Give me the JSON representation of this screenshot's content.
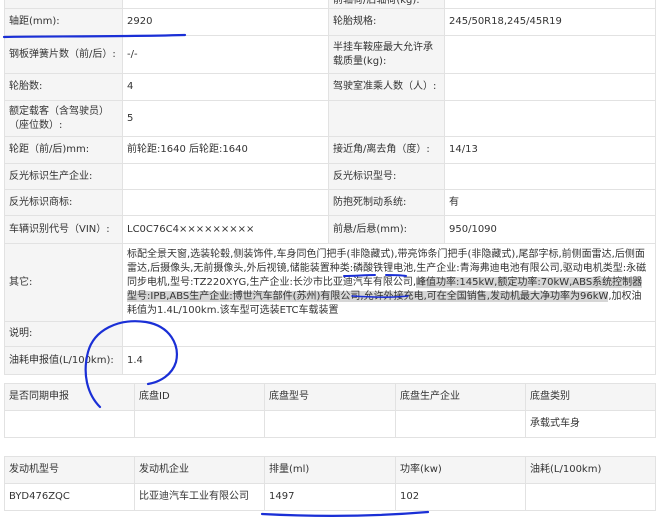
{
  "spec_rows": [
    {
      "l1": "",
      "v1": "",
      "l2": "前轴荷/后轴荷(kg):",
      "v2": ""
    },
    {
      "l1": "轴距(mm):",
      "v1": "2920",
      "l2": "轮胎规格:",
      "v2": "245/50R18,245/45R19"
    },
    {
      "l1": "钢板弹簧片数（前/后）:",
      "v1": "-/-",
      "l2": "半挂车鞍座最大允许承载质量(kg):",
      "v2": ""
    },
    {
      "l1": "轮胎数:",
      "v1": "4",
      "l2": "驾驶室准乘人数（人）:",
      "v2": ""
    },
    {
      "l1": "额定载客（含驾驶员）（座位数）:",
      "v1": "5",
      "l2": "",
      "v2": ""
    },
    {
      "l1": "轮距（前/后)mm:",
      "v1": "前轮距:1640 后轮距:1640",
      "l2": "接近角/离去角（度）:",
      "v2": "14/13"
    },
    {
      "l1": "反光标识生产企业:",
      "v1": "",
      "l2": "反光标识型号:",
      "v2": ""
    },
    {
      "l1": "反光标识商标:",
      "v1": "",
      "l2": "防抱死制动系统:",
      "v2": "有"
    },
    {
      "l1": "车辆识别代号（VIN）:",
      "v1": "LC0C76C4×××××××××",
      "l2": "前悬/后悬(mm):",
      "v2": "950/1090"
    }
  ],
  "other": {
    "label": "其它:",
    "text_a": "标配全景天窗,选装轮毂,侧装饰件,车身同色门把手(非隐藏式),带亮饰条门把手(非隐藏式),尾部字标,前侧面雷达,后侧面雷达,后摄像头,无前摄像头,外后视镜,储能装置种类:磷酸铁锂电池,生产企业:青海弗迪电池有限公司,驱动电机类型:永磁同步电机,型号:TZ220XYG,生产企业:长沙市比亚迪汽车有限公司,",
    "text_hl": "峰值功率:145kW,额定功率:70kW,ABS系统控制器型号:IPB,ABS生产企业:博世汽车部件(苏州)有限公司,允许外接充电,可在全国销售,发动机最大净功率为96kW",
    "text_b": ",加权油耗值为1.4L/100km.该车型可选装ETC车载装置"
  },
  "remark": {
    "label": "说明:",
    "value": ""
  },
  "fuel": {
    "label": "油耗申报值(L/100km):",
    "value": "1.4"
  },
  "chassis": {
    "headers": [
      "是否同期申报",
      "底盘ID",
      "底盘型号",
      "底盘生产企业",
      "底盘类别"
    ],
    "row": [
      "",
      "",
      "",
      "",
      "承载式车身"
    ]
  },
  "engine": {
    "headers": [
      "发动机型号",
      "发动机企业",
      "排量(ml)",
      "功率(kw)",
      "油耗(L/100km)"
    ],
    "row": [
      "BYD476ZQC",
      "比亚迪汽车工业有限公司",
      "1497",
      "102",
      ""
    ]
  },
  "ink_color": "#1a2fd6"
}
